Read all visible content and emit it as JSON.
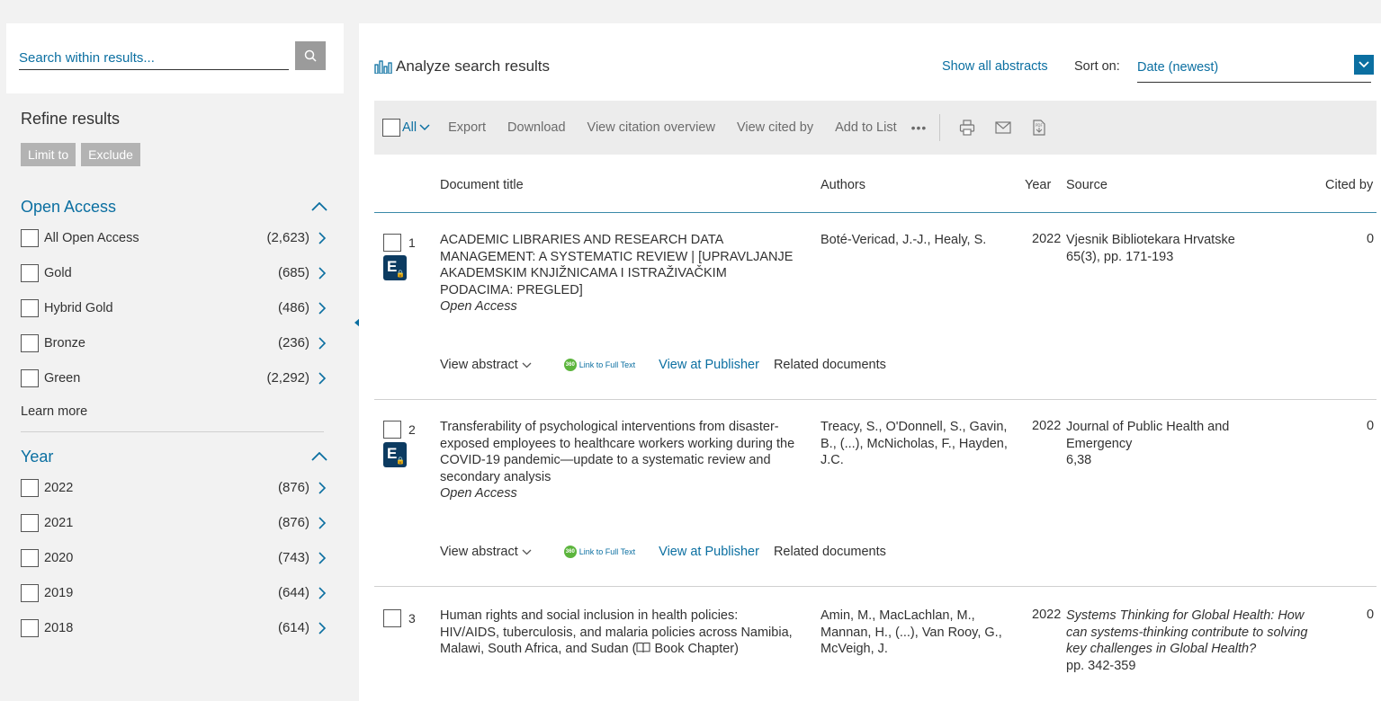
{
  "sidebar": {
    "search_placeholder": "Search within results...",
    "refine_title": "Refine results",
    "limit_to": "Limit to",
    "exclude": "Exclude",
    "open_access": {
      "title": "Open Access",
      "items": [
        {
          "label": "All Open Access",
          "count": "(2,623)"
        },
        {
          "label": "Gold",
          "count": "(685)"
        },
        {
          "label": "Hybrid Gold",
          "count": "(486)"
        },
        {
          "label": "Bronze",
          "count": "(236)"
        },
        {
          "label": "Green",
          "count": "(2,292)"
        }
      ],
      "learn_more": "Learn more"
    },
    "year": {
      "title": "Year",
      "items": [
        {
          "label": "2022",
          "count": "(876)"
        },
        {
          "label": "2021",
          "count": "(876)"
        },
        {
          "label": "2020",
          "count": "(743)"
        },
        {
          "label": "2019",
          "count": "(644)"
        },
        {
          "label": "2018",
          "count": "(614)"
        }
      ]
    }
  },
  "main": {
    "analyze_label": "Analyze search results",
    "show_all_abstracts": "Show all abstracts",
    "sort_label": "Sort on:",
    "sort_value": "Date (newest)",
    "toolbar": {
      "all": "All",
      "export": "Export",
      "download": "Download",
      "view_citation_overview": "View citation overview",
      "view_cited_by": "View cited by",
      "add_to_list": "Add to List",
      "more": "•••"
    },
    "columns": {
      "title": "Document title",
      "authors": "Authors",
      "year": "Year",
      "source": "Source",
      "cited_by": "Cited by"
    },
    "results": [
      {
        "num": "1",
        "title": "ACADEMIC LIBRARIES AND RESEARCH DATA MANAGEMENT: A SYSTEMATIC REVIEW | [UPRAVLJANJE AKADEMSKIM KNJIŽNICAMA I ISTRAŽIVAČKIM PODACIMA: PREGLED]",
        "access": "Open Access",
        "authors": "Boté-Vericad, J.-J., Healy, S.",
        "year": "2022",
        "source_main": "Vjesnik Bibliotekara Hrvatske",
        "source_detail": "65(3), pp. 171-193",
        "cited": "0"
      },
      {
        "num": "2",
        "title": "Transferability of psychological interventions from disaster-exposed employees to healthcare workers working during the COVID-19 pandemic—update to a systematic review and secondary analysis",
        "access": "Open Access",
        "authors": "Treacy, S., O'Donnell, S., Gavin, B., (...), McNicholas, F., Hayden, J.C.",
        "year": "2022",
        "source_main": "Journal of Public Health and Emergency",
        "source_detail": "6,38",
        "cited": "0"
      },
      {
        "num": "3",
        "title": "Human rights and social inclusion in health policies: HIV/AIDS, tuberculosis, and malaria policies across Namibia, Malawi, South Africa, and Sudan (",
        "title_book": " Book Chapter)",
        "authors": "Amin, M., MacLachlan, M., Mannan, H., (...), Van Rooy, G., McVeigh, J.",
        "year": "2022",
        "source_main": "Systems Thinking for Global Health: How can systems-thinking contribute to solving key challenges in Global Health?",
        "source_detail": "pp. 342-359",
        "cited": "0"
      }
    ],
    "actions": {
      "view_abstract": "View abstract",
      "link_full_text": "Link to Full Text",
      "view_at_publisher": "View at Publisher",
      "related_documents": "Related documents"
    }
  }
}
